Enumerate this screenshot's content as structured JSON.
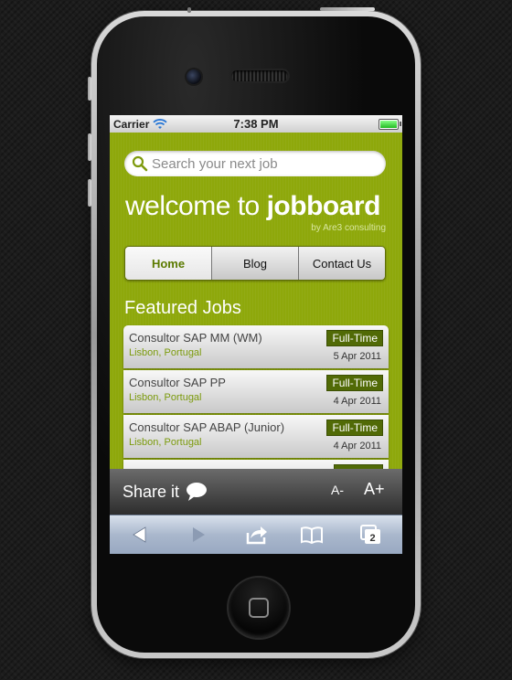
{
  "status_bar": {
    "carrier": "Carrier",
    "time": "7:38 PM"
  },
  "search": {
    "placeholder": "Search your next job"
  },
  "brand": {
    "prefix": "welcome to ",
    "name": "jobboard",
    "byline": "by Are3 consulting"
  },
  "nav": [
    {
      "label": "Home",
      "active": true
    },
    {
      "label": "Blog",
      "active": false
    },
    {
      "label": "Contact Us",
      "active": false
    }
  ],
  "featured_title": "Featured Jobs",
  "jobs": [
    {
      "title": "Consultor SAP MM (WM)",
      "location": "Lisbon, Portugal",
      "type": "Full-Time",
      "date": "5 Apr 2011"
    },
    {
      "title": "Consultor SAP PP",
      "location": "Lisbon, Portugal",
      "type": "Full-Time",
      "date": "4 Apr 2011"
    },
    {
      "title": "Consultor SAP ABAP (Junior)",
      "location": "Lisbon, Portugal",
      "type": "Full-Time",
      "date": "4 Apr 2011"
    }
  ],
  "share_bar": {
    "label": "Share it",
    "font_decrease": "A-",
    "font_increase": "A+"
  },
  "safari_toolbar": {
    "icons": [
      "back-icon",
      "forward-icon",
      "share-icon",
      "bookmarks-icon",
      "tabs-icon"
    ],
    "tabs_count": "2"
  },
  "colors": {
    "accent": "#8ea80b",
    "badge": "#516a06",
    "location": "#7b9a0c"
  }
}
